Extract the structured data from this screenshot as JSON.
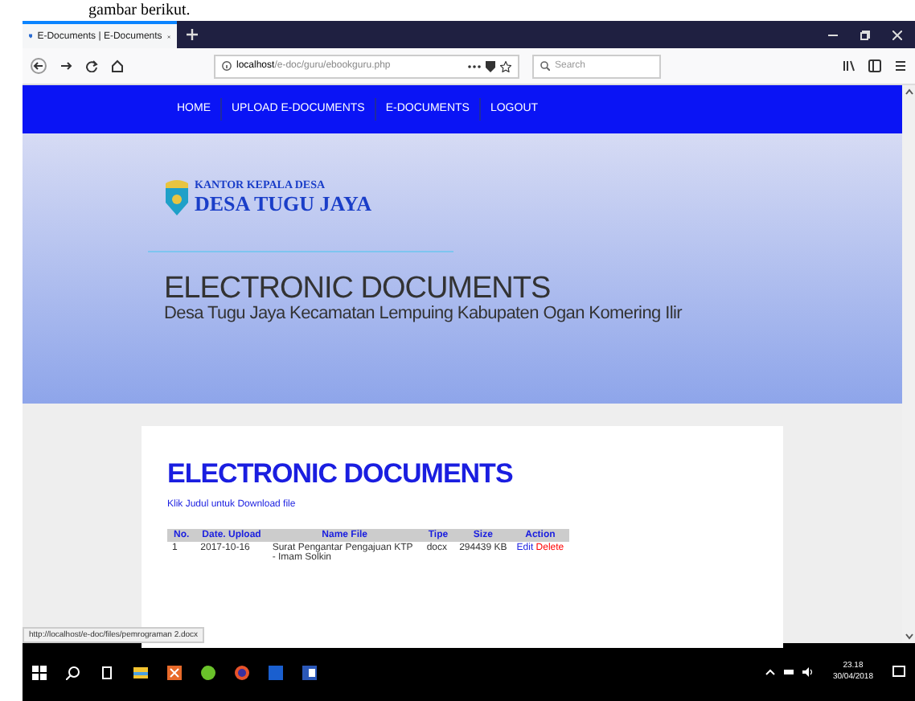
{
  "document_text": "gambar berikut.",
  "browser": {
    "tab_title": "E-Documents | E-Documents",
    "url_host": "localhost",
    "url_path": "/e-doc/guru/ebookguru.php",
    "search_placeholder": "Search"
  },
  "nav": [
    {
      "label": "HOME"
    },
    {
      "label": "UPLOAD E-DOCUMENTS"
    },
    {
      "label": "E-DOCUMENTS"
    },
    {
      "label": "LOGOUT"
    }
  ],
  "header": {
    "logo_line1": "KANTOR KEPALA DESA",
    "logo_line2": "DESA TUGU JAYA",
    "title": "ELECTRONIC DOCUMENTS",
    "subtitle": "Desa Tugu Jaya Kecamatan Lempuing Kabupaten Ogan Komering Ilir"
  },
  "content": {
    "heading": "ELECTRONIC DOCUMENTS",
    "hint": "Klik Judul untuk Download file",
    "table": {
      "columns": [
        "No.",
        "Date. Upload",
        "Name File",
        "Tipe",
        "Size",
        "Action"
      ],
      "rows": [
        {
          "cells": [
            "1",
            "2017-10-16",
            "Surat Pengantar Pengajuan KTP - Imam Solkin",
            "docx",
            "294439 KB"
          ],
          "actions": [
            {
              "label": "Edit",
              "kind": "edit"
            },
            {
              "label": "Delete",
              "kind": "delete"
            }
          ]
        }
      ]
    }
  },
  "status_url": "http://localhost/e-doc/files/pemrograman 2.docx",
  "taskbar": {
    "time": "23.18",
    "date": "30/04/2018"
  }
}
